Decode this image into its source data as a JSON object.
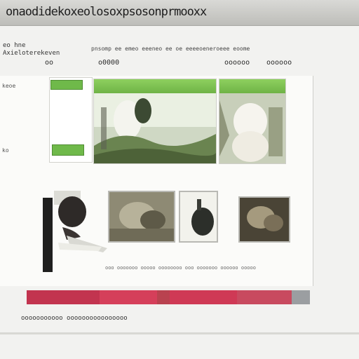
{
  "banner": {
    "text": "onaodidekoxeolosoxpsosonprmooxx"
  },
  "header": {
    "subtitle": "eo hne\nAxieloterekeven",
    "tagline": "pnsomp ee emeo eeeneo ee oe eeeeoeneroeee eoome"
  },
  "nav": {
    "items": [
      {
        "label": "oo"
      },
      {
        "label": "o0000"
      },
      {
        "label": "oooooo"
      },
      {
        "label": "oooooo"
      }
    ]
  },
  "left": {
    "label_top": "keoe",
    "label_bottom": "ko"
  },
  "captions": {
    "text": "ooo ooooooo ooooo oooooooo ooo ooooooo oooooo ooooo"
  },
  "strip": {
    "colors": [
      "#c2344f",
      "#d53f5a",
      "#b9424f",
      "#cf3955",
      "#c84a5f",
      "#9b9ea1"
    ]
  },
  "footer": {
    "text": "ooooooooooo oooooooooooooooo"
  },
  "colors": {
    "accent_green": "#6fb346",
    "strip_red": "#c8384f"
  }
}
